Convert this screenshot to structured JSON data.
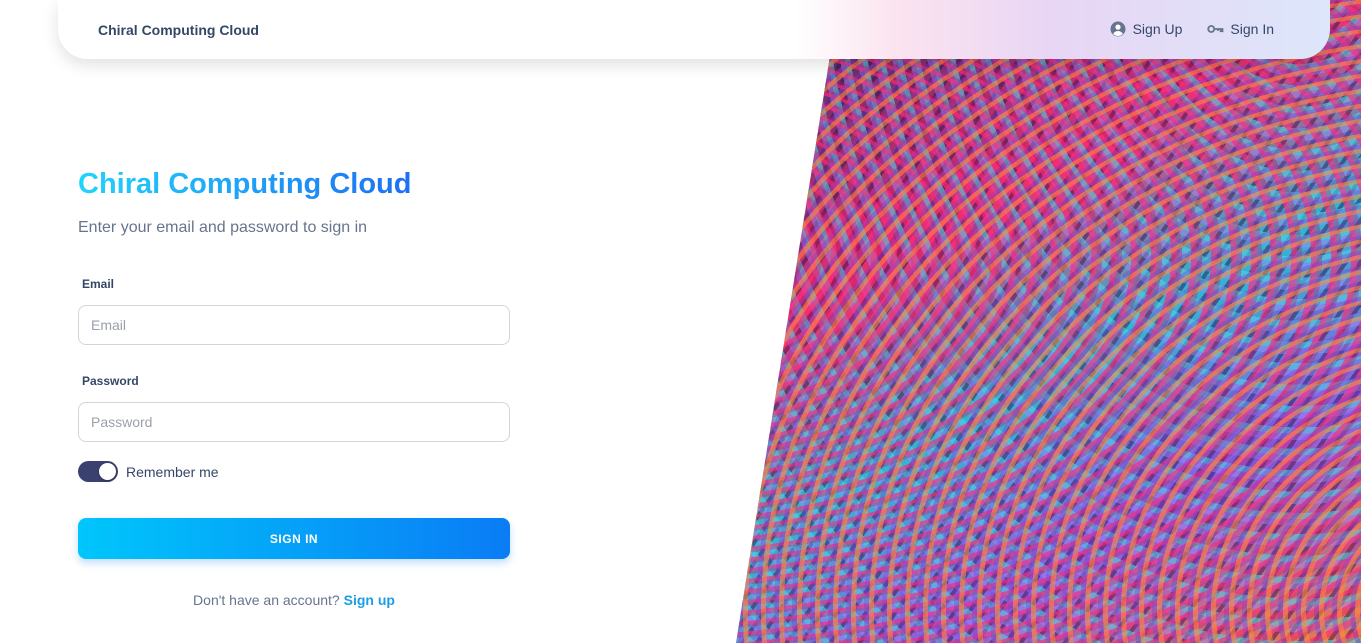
{
  "navbar": {
    "brand": "Chiral Computing Cloud",
    "links": [
      {
        "label": "Sign Up",
        "icon": "account-circle-icon"
      },
      {
        "label": "Sign In",
        "icon": "key-icon"
      }
    ]
  },
  "form": {
    "title": "Chiral Computing Cloud",
    "subtitle": "Enter your email and password to sign in",
    "email": {
      "label": "Email",
      "placeholder": "Email",
      "value": ""
    },
    "password": {
      "label": "Password",
      "placeholder": "Password",
      "value": ""
    },
    "remember_label": "Remember me",
    "remember_checked": true,
    "submit_label": "SIGN IN",
    "footer_text": "Don't have an account?",
    "footer_link": "Sign up"
  },
  "colors": {
    "accent_start": "#21d4fd",
    "accent_end": "#1d6ff2",
    "text_dark": "#344767",
    "text_muted": "#67748e",
    "toggle_on": "#3a416f"
  }
}
